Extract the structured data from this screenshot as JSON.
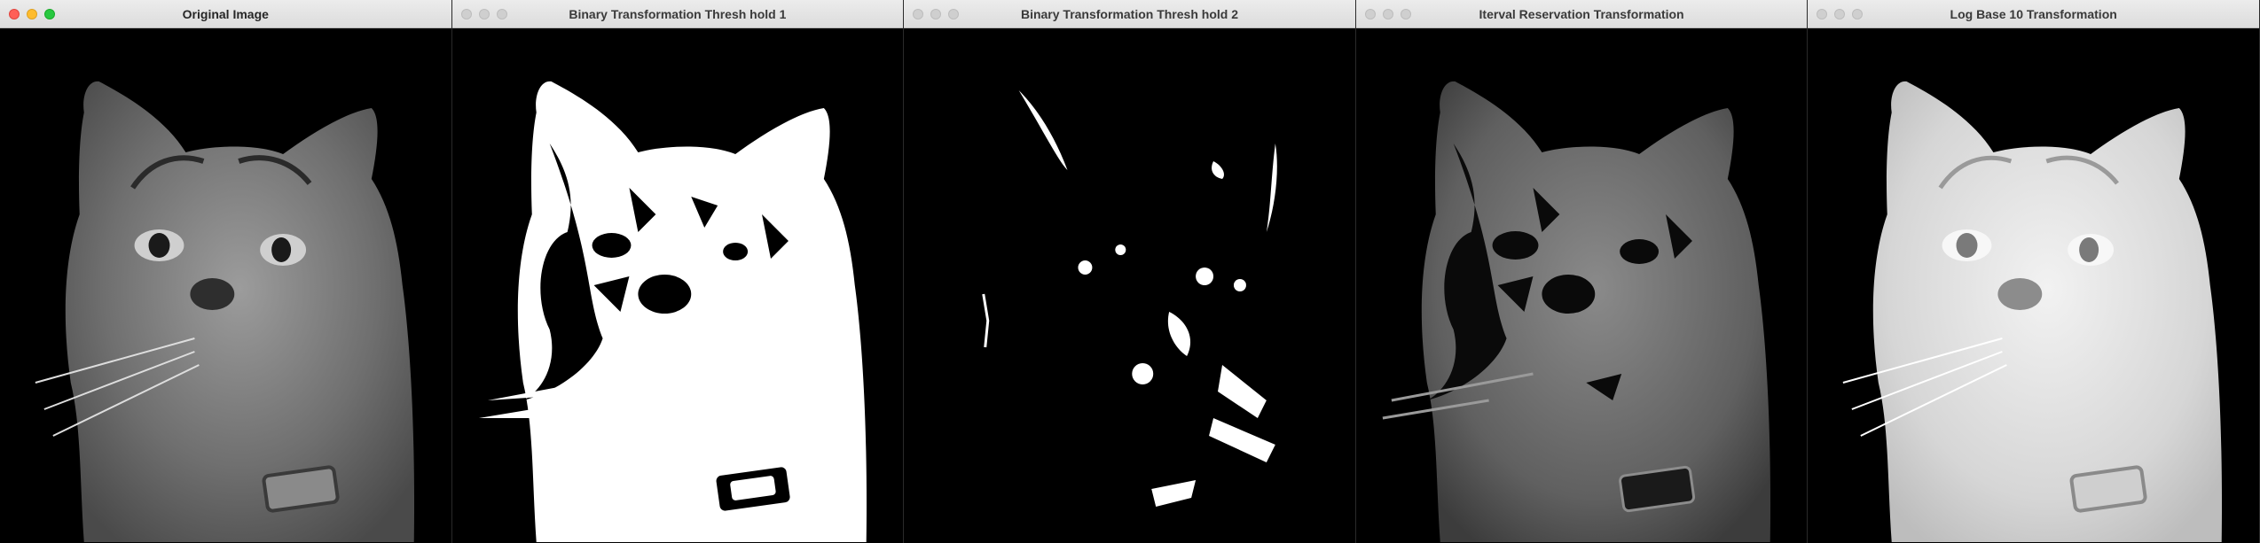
{
  "windows": [
    {
      "title": "Original Image",
      "active": true,
      "image": "original-grayscale-cat-photo"
    },
    {
      "title": "Binary Transformation Thresh hold 1",
      "active": false,
      "image": "binary-threshold-1-cat"
    },
    {
      "title": "Binary Transformation Thresh hold 2",
      "active": false,
      "image": "binary-threshold-2-cat"
    },
    {
      "title": "Iterval Reservation Transformation",
      "active": false,
      "image": "interval-reservation-cat"
    },
    {
      "title": "Log Base 10 Transformation",
      "active": false,
      "image": "log-base-10-cat"
    }
  ],
  "colors": {
    "canvas_background": "#000000",
    "titlebar": "#e3e3e3",
    "close_light": "#ff5f57",
    "minimize_light": "#febc2e",
    "zoom_light": "#28c840"
  }
}
